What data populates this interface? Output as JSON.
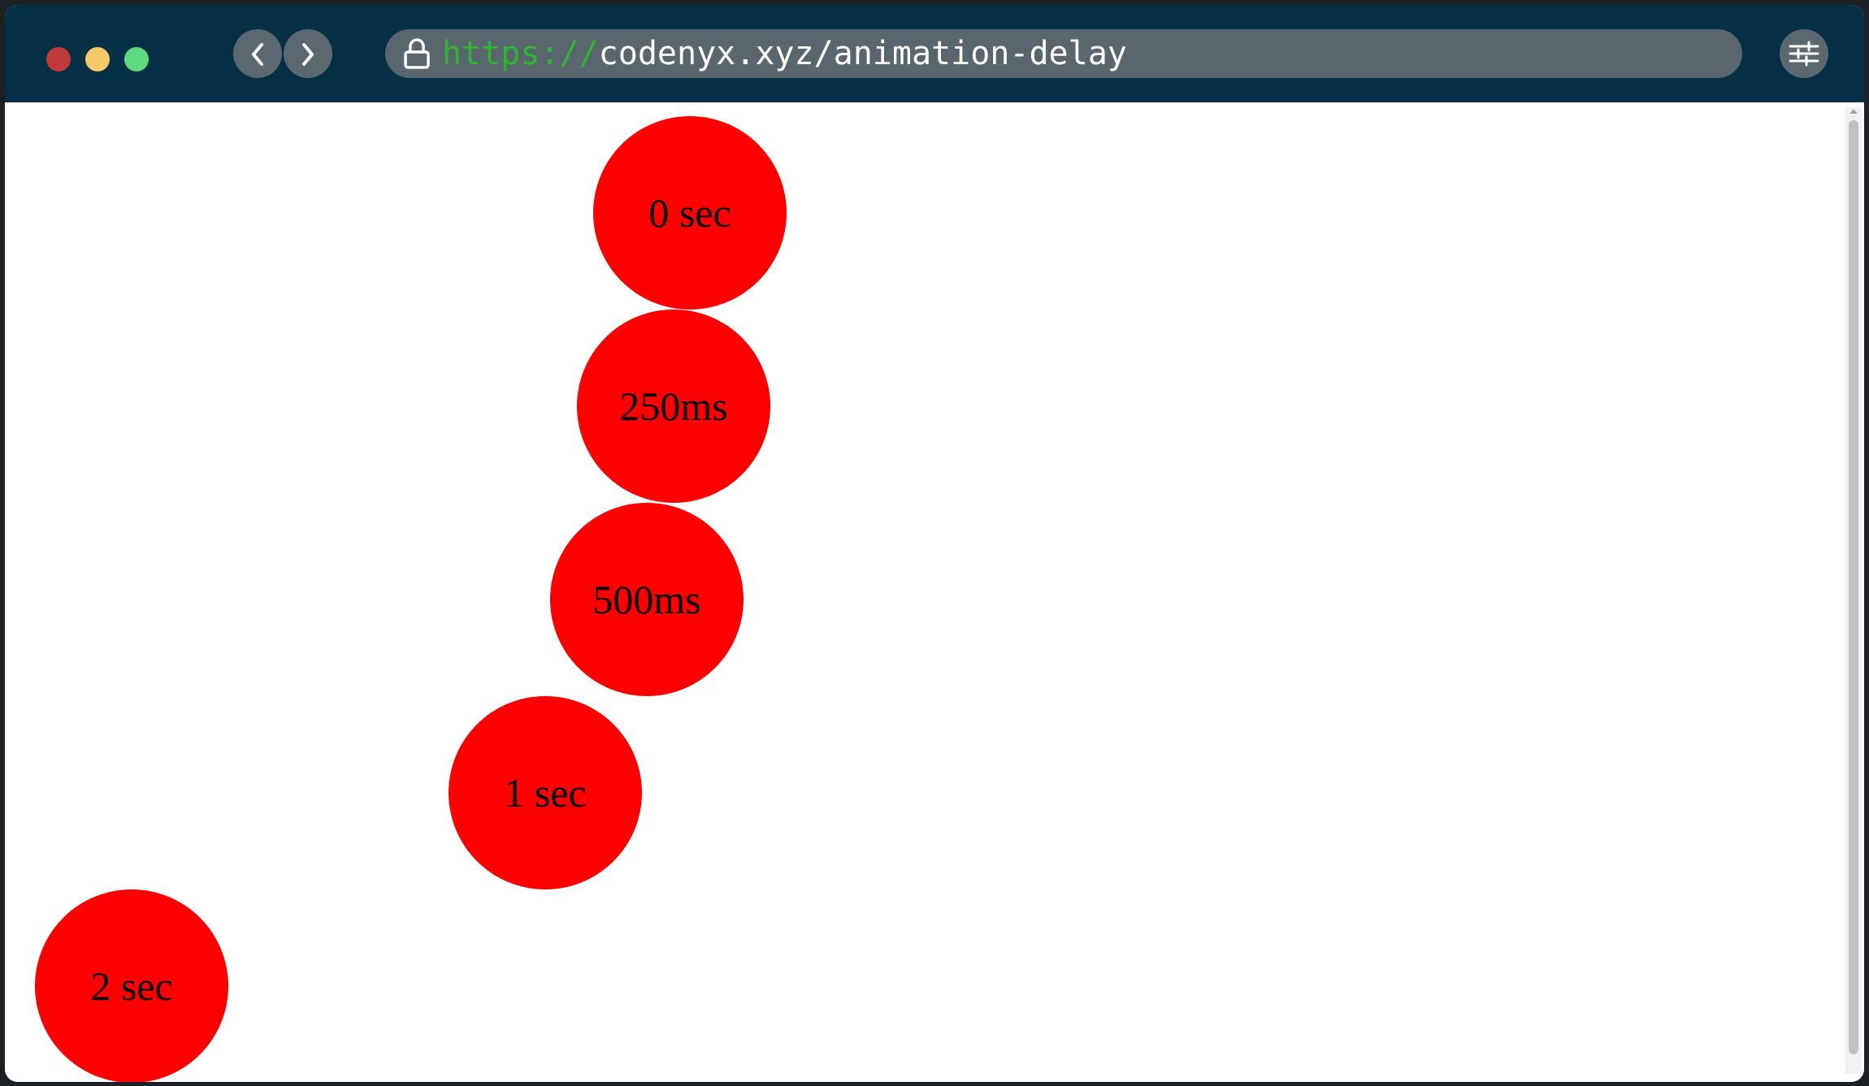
{
  "window": {
    "traffic_lights": {
      "close_color": "#c0393b",
      "minimize_color": "#f5c86a",
      "maximize_color": "#5fd97f"
    }
  },
  "toolbar": {
    "back_icon": "chevron-left-icon",
    "forward_icon": "chevron-right-icon",
    "settings_icon": "sliders-icon"
  },
  "address_bar": {
    "lock_icon": "lock-icon",
    "scheme": "https://",
    "path": "codenyx.xyz/animation-delay",
    "scheme_color": "#2fb52f"
  },
  "page": {
    "accent_color": "#ff0000",
    "balls": [
      {
        "label": "0 sec"
      },
      {
        "label": "250ms"
      },
      {
        "label": "500ms"
      },
      {
        "label": "1 sec"
      },
      {
        "label": "2 sec"
      }
    ]
  }
}
